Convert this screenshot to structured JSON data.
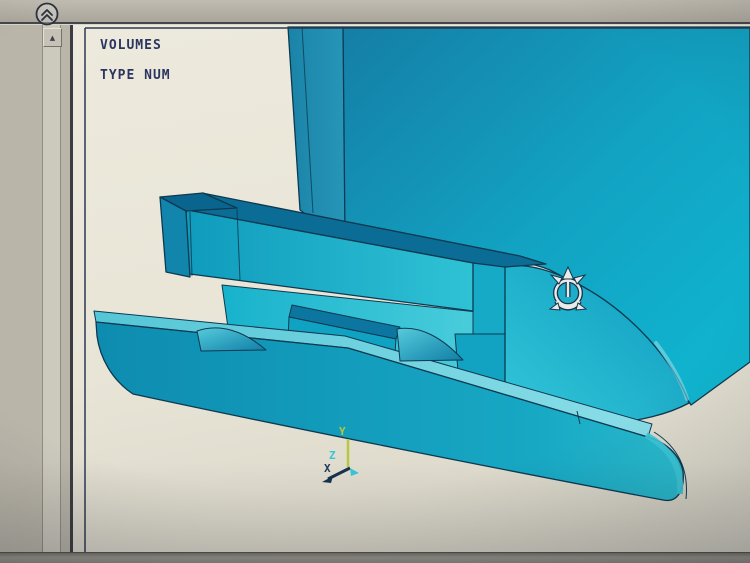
{
  "window": {
    "collapse_button": {
      "icon": "double-chevron-up-icon"
    },
    "scrollbar": {
      "up_glyph": "▲"
    }
  },
  "graphics": {
    "annotation_line_1": "VOLUMES",
    "annotation_line_2": "TYPE NUM",
    "triad": {
      "x": "X",
      "y": "Y",
      "z": "Z"
    },
    "symbol": "coordinate-system-icon"
  },
  "colors": {
    "annotation_navy": "#2b3560",
    "model_edge_navy": "#0e3950",
    "model_teal_bright": "#14b2cc",
    "model_teal_dark": "#0b6c96",
    "background_cream": "#eae7da",
    "chrome_gray": "#b2aea3",
    "triad_y_green": "#b5c83e",
    "triad_z_cyan": "#38c4da",
    "triad_x_navy": "#1e3a5e"
  }
}
